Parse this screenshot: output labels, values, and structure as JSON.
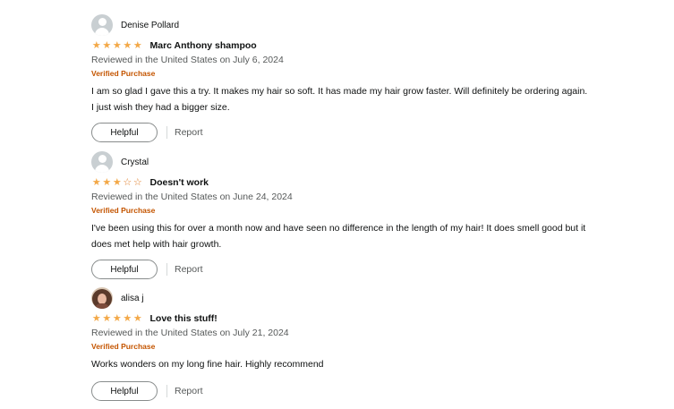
{
  "reviews": [
    {
      "name": "Denise Pollard",
      "rating": 5,
      "title": "Marc Anthony shampoo",
      "date": "Reviewed in the United States on July 6, 2024",
      "badge": "Verified Purchase",
      "body": "I am so glad I gave this a try. It makes my hair so soft. It has made my hair grow faster. Will definitely be ordering again. I just wish they had a bigger size.",
      "helpful_label": "Helpful",
      "report_label": "Report"
    },
    {
      "name": "Crystal",
      "rating": 3,
      "title": "Doesn't work",
      "date": "Reviewed in the United States on June 24, 2024",
      "badge": "Verified Purchase",
      "body": "I've been using this for over a month now and have seen no difference in the length of my hair! It does smell good but it does met help with hair growth.",
      "helpful_label": "Helpful",
      "report_label": "Report"
    },
    {
      "name": "alisa j",
      "rating": 5,
      "title": "Love this stuff!",
      "date": "Reviewed in the United States on July 21, 2024",
      "badge": "Verified Purchase",
      "body": "Works wonders on my long fine hair. Highly recommend",
      "helpful_label": "Helpful",
      "report_label": "Report"
    }
  ],
  "colors": {
    "star": "#f3a847",
    "verified": "#c45500",
    "muted_text": "#565959"
  }
}
